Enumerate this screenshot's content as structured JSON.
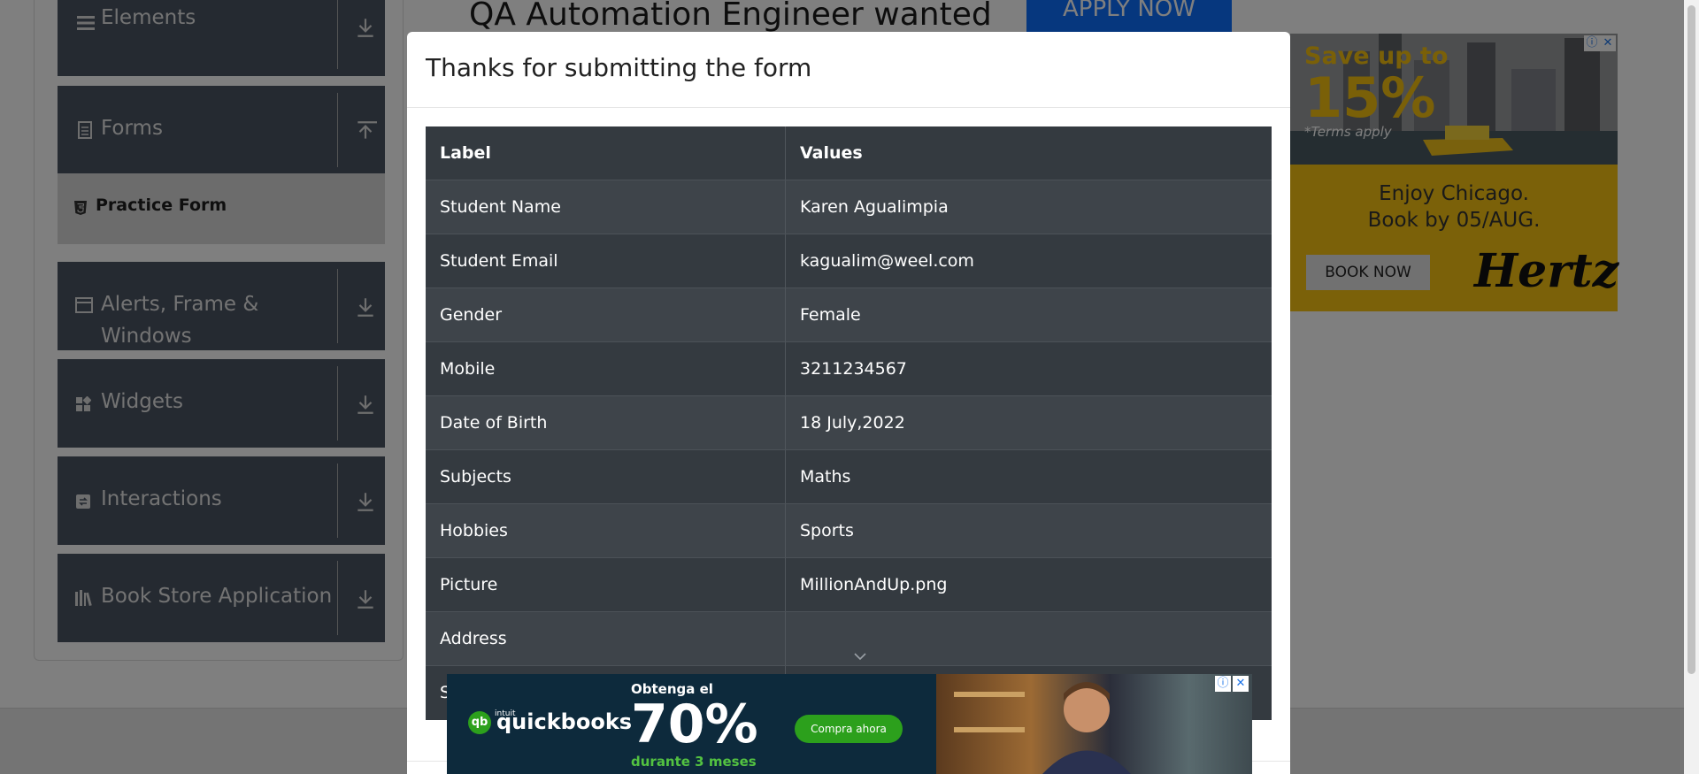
{
  "sidebar": {
    "groups": [
      {
        "label": "Elements",
        "icon": "hamburger-icon",
        "arrow": "download-icon"
      },
      {
        "label": "Forms",
        "icon": "document-icon",
        "arrow": "upload-icon"
      },
      {
        "label": "Alerts, Frame & Windows",
        "icon": "window-icon",
        "arrow": "download-icon"
      },
      {
        "label": "Widgets",
        "icon": "widgets-icon",
        "arrow": "download-icon"
      },
      {
        "label": "Interactions",
        "icon": "interaction-icon",
        "arrow": "download-icon"
      },
      {
        "label": "Book Store Application",
        "icon": "books-icon",
        "arrow": "download-icon"
      }
    ],
    "active_item": {
      "label": "Practice Form",
      "icon": "html5-icon"
    }
  },
  "main": {
    "banner_title": "QA Automation Engineer wanted",
    "apply_label": "APPLY NOW"
  },
  "ad_right": {
    "save_text": "Save up to",
    "percent": "15%",
    "terms": "*Terms apply",
    "line1": "Enjoy Chicago.",
    "line2": "Book by 05/AUG.",
    "book_label": "BOOK NOW",
    "brand": "Hertz"
  },
  "modal": {
    "title": "Thanks for submitting the form",
    "header": {
      "label": "Label",
      "value": "Values"
    },
    "rows": [
      {
        "label": "Student Name",
        "value": "Karen Agualimpia"
      },
      {
        "label": "Student Email",
        "value": "kagualim@weel.com"
      },
      {
        "label": "Gender",
        "value": "Female"
      },
      {
        "label": "Mobile",
        "value": "3211234567"
      },
      {
        "label": "Date of Birth",
        "value": "18 July,2022"
      },
      {
        "label": "Subjects",
        "value": "Maths"
      },
      {
        "label": "Hobbies",
        "value": "Sports"
      },
      {
        "label": "Picture",
        "value": "MillionAndUp.png"
      },
      {
        "label": "Address",
        "value": ""
      },
      {
        "label": "S",
        "value": ""
      }
    ]
  },
  "ad_bottom": {
    "brand": "quickbooks",
    "brand_prefix": "intuit",
    "qb_mark": "qb",
    "offer_prefix": "Obtenga el",
    "offer_percent": "70%",
    "offer_suffix": "durante 3 meses",
    "cta": "Compra ahora"
  },
  "colors": {
    "sidebar_bg": "#4b5563",
    "table_dark": "#343a40",
    "table_mid": "#3e444a",
    "accent_blue": "#0d6efd",
    "ad_yellow": "#f6c313",
    "qb_green": "#2ca01c"
  }
}
